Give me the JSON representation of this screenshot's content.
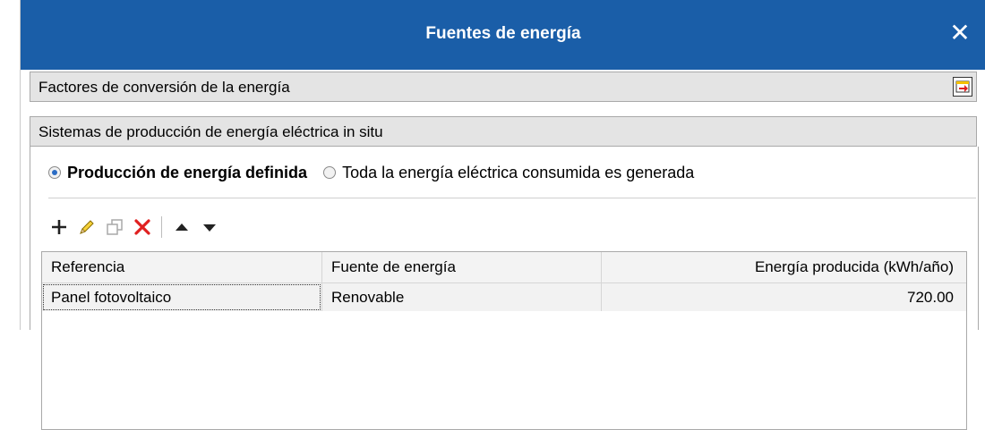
{
  "window": {
    "title": "Fuentes de energía",
    "close_icon": "close-icon",
    "colors": {
      "titlebar": "#1a5ea8",
      "accent": "#2b6cc4",
      "delete": "#e02020"
    }
  },
  "sections": {
    "conversion": {
      "label": "Factores de conversión de la energía",
      "export_icon": "export-icon"
    },
    "production": {
      "label": "Sistemas de producción de energía eléctrica in situ"
    }
  },
  "radio": {
    "option1": {
      "label": "Producción de energía definida",
      "checked": true
    },
    "option2": {
      "label": "Toda la energía eléctrica consumida es generada",
      "checked": false
    }
  },
  "toolbar": {
    "icons": [
      "add-icon",
      "edit-icon",
      "copy-icon",
      "delete-icon",
      "move-up-icon",
      "move-down-icon"
    ]
  },
  "table": {
    "columns": [
      "Referencia",
      "Fuente de energía",
      "Energía producida (kWh/año)"
    ],
    "rows": [
      [
        "Panel fotovoltaico",
        "Renovable",
        "720.00"
      ]
    ]
  }
}
